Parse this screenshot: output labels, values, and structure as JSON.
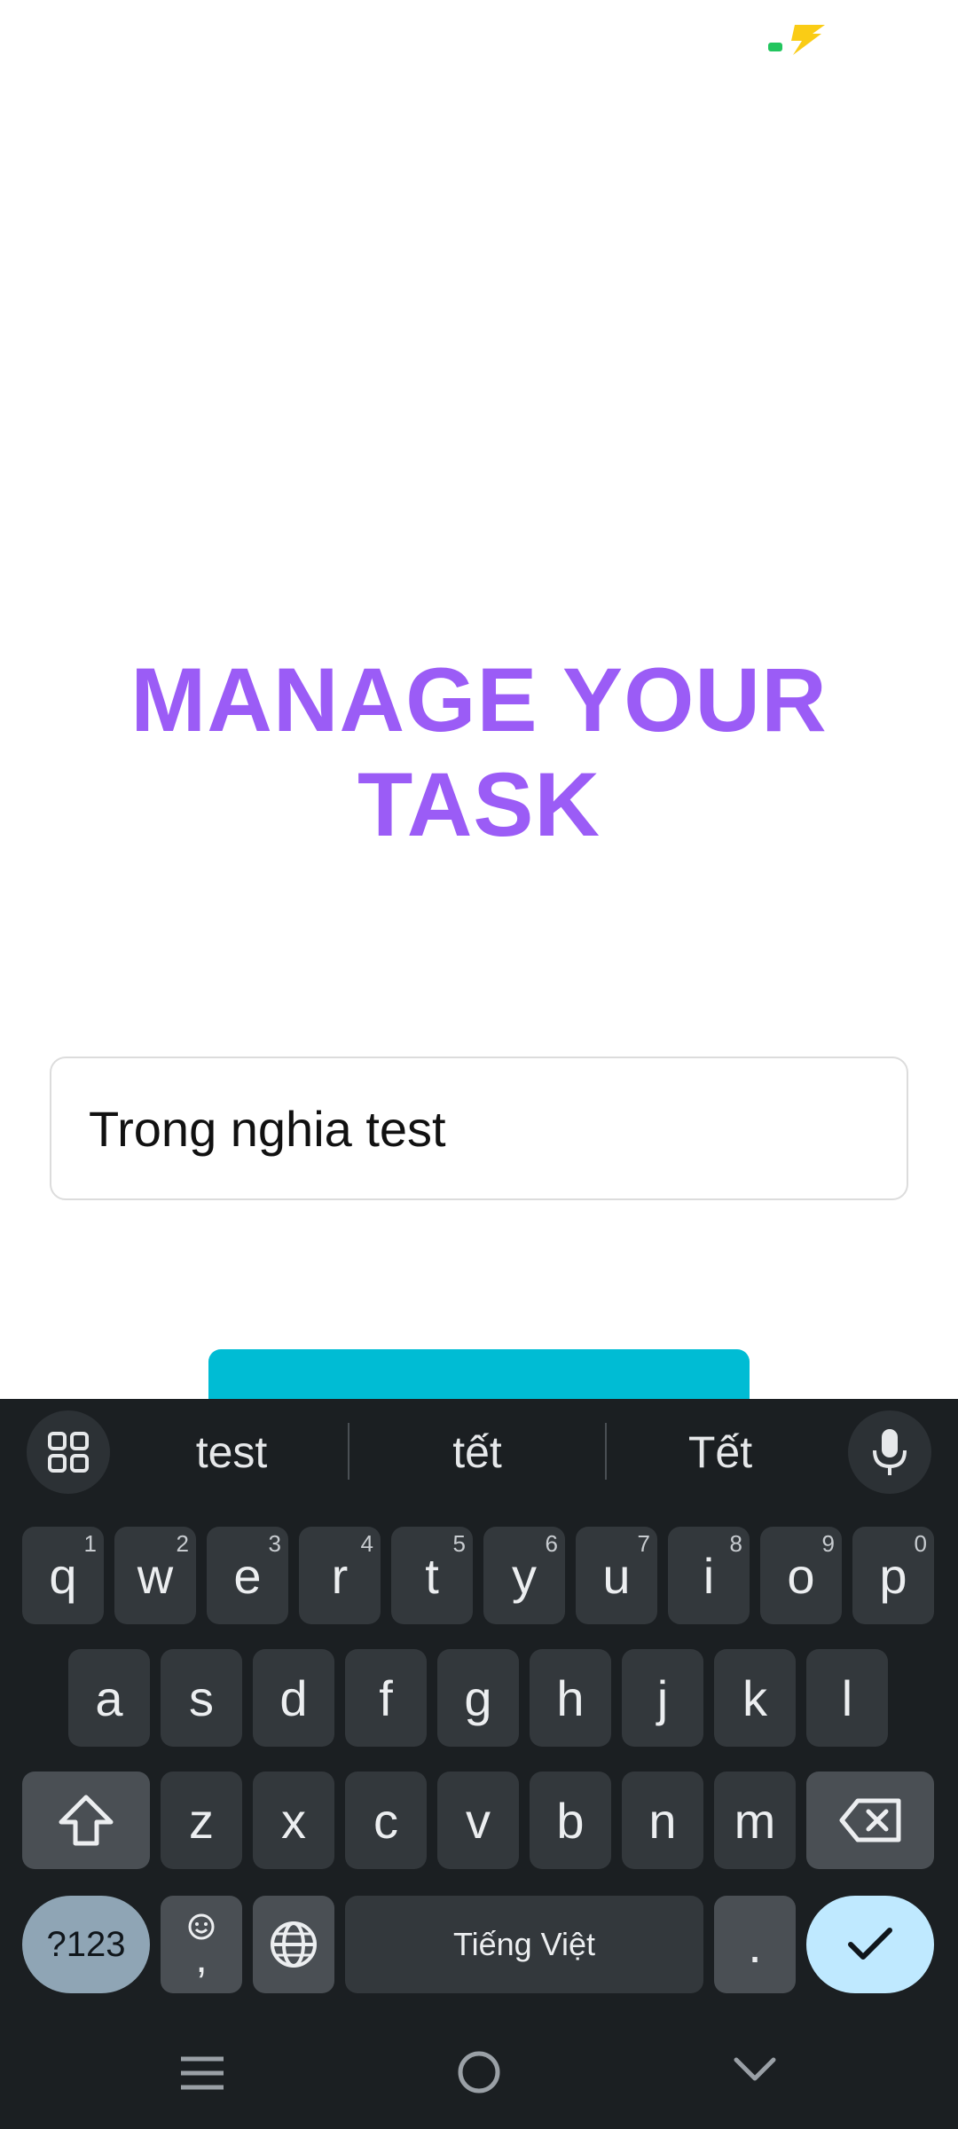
{
  "status_bar": {
    "battery_icon": "battery-charging-icon",
    "battery_color": "#22c55e",
    "bolt_color": "#facc15"
  },
  "main": {
    "title_line1": "MANAGE YOUR",
    "title_line2": "TASK",
    "title_color": "#9b5cf6",
    "task_input_value": "Trong nghia test",
    "submit_button_color": "#00bcd4"
  },
  "keyboard": {
    "suggestions": [
      "test",
      "tết",
      "Tết"
    ],
    "apps_icon": "grid-apps-icon",
    "mic_icon": "microphone-icon",
    "row1": [
      {
        "label": "q",
        "hint": "1"
      },
      {
        "label": "w",
        "hint": "2"
      },
      {
        "label": "e",
        "hint": "3"
      },
      {
        "label": "r",
        "hint": "4"
      },
      {
        "label": "t",
        "hint": "5"
      },
      {
        "label": "y",
        "hint": "6"
      },
      {
        "label": "u",
        "hint": "7"
      },
      {
        "label": "i",
        "hint": "8"
      },
      {
        "label": "o",
        "hint": "9"
      },
      {
        "label": "p",
        "hint": "0"
      }
    ],
    "row2": [
      "a",
      "s",
      "d",
      "f",
      "g",
      "h",
      "j",
      "k",
      "l"
    ],
    "row3": [
      "z",
      "x",
      "c",
      "v",
      "b",
      "n",
      "m"
    ],
    "shift_icon": "shift-icon",
    "backspace_icon": "backspace-icon",
    "symbols_label": "?123",
    "emoji_icon": "emoji-icon",
    "comma_label": ",",
    "globe_icon": "globe-icon",
    "space_label": "Tiếng Việt",
    "period_label": ".",
    "enter_icon": "checkmark-icon"
  },
  "nav_bar": {
    "recents_icon": "menu-lines-icon",
    "home_icon": "home-circle-icon",
    "back_icon": "chevron-down-icon"
  }
}
